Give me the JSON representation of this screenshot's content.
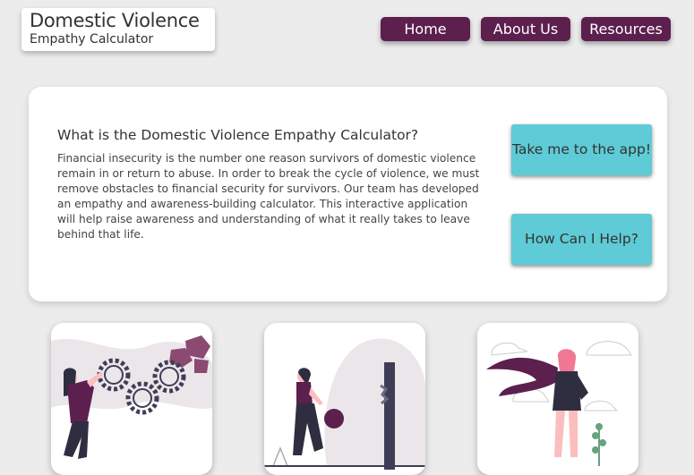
{
  "header": {
    "logo_title": "Domestic Violence",
    "logo_subtitle": "Empathy Calculator",
    "nav": [
      {
        "label": "Home"
      },
      {
        "label": "About Us"
      },
      {
        "label": "Resources"
      }
    ]
  },
  "intro": {
    "heading": "What is the Domestic Violence Empathy Calculator?",
    "body": "Financial insecurity is the number one reason survivors of domestic violence remain in or return to abuse. In order to break the cycle of violence, we must remove obstacles to financial security for survivors. Our team has developed an empathy and awareness-building calculator. This interactive application will help raise awareness and understanding of what it really takes to leave behind that life.",
    "app_button": "Take me to the app!",
    "help_button": "How Can I Help?"
  },
  "colors": {
    "nav_bg": "#5c1f4e",
    "accent_teal": "#5ecbd6",
    "illustration_purple": "#5c1f4e",
    "illustration_dark": "#2f2e41"
  },
  "illustrations": [
    {
      "name": "woman-gears-illustration"
    },
    {
      "name": "woman-ball-door-illustration"
    },
    {
      "name": "superhero-woman-illustration"
    }
  ]
}
